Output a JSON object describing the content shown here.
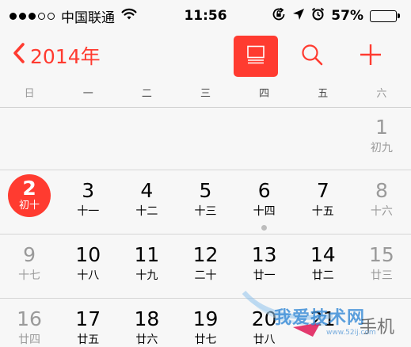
{
  "status_bar": {
    "signal_dots": [
      true,
      true,
      true,
      false,
      false
    ],
    "carrier": "中国联通",
    "wifi_icon": "wifi-icon",
    "time": "11:56",
    "lock_rotation_icon": "orientation-lock-icon",
    "location_icon": "location-arrow-icon",
    "alarm_icon": "alarm-clock-icon",
    "battery_percent": "57%",
    "battery_level": 0.57
  },
  "nav": {
    "back_label": "2014年",
    "back_icon": "chevron-left-icon",
    "list_icon": "list-view-icon",
    "search_icon": "search-icon",
    "add_icon": "plus-icon",
    "accent_color": "#ff3b30"
  },
  "weekdays": [
    "日",
    "一",
    "二",
    "三",
    "四",
    "五",
    "六"
  ],
  "weeks": [
    [
      {
        "day": "",
        "lunar": ""
      },
      {
        "day": "",
        "lunar": ""
      },
      {
        "day": "",
        "lunar": ""
      },
      {
        "day": "",
        "lunar": ""
      },
      {
        "day": "",
        "lunar": ""
      },
      {
        "day": "",
        "lunar": ""
      },
      {
        "day": "1",
        "lunar": "初九"
      }
    ],
    [
      {
        "day": "2",
        "lunar": "初十",
        "today": true
      },
      {
        "day": "3",
        "lunar": "十一"
      },
      {
        "day": "4",
        "lunar": "十二"
      },
      {
        "day": "5",
        "lunar": "十三"
      },
      {
        "day": "6",
        "lunar": "十四",
        "event": true
      },
      {
        "day": "7",
        "lunar": "十五"
      },
      {
        "day": "8",
        "lunar": "十六"
      }
    ],
    [
      {
        "day": "9",
        "lunar": "十七"
      },
      {
        "day": "10",
        "lunar": "十八"
      },
      {
        "day": "11",
        "lunar": "十九"
      },
      {
        "day": "12",
        "lunar": "二十"
      },
      {
        "day": "13",
        "lunar": "廿一"
      },
      {
        "day": "14",
        "lunar": "廿二"
      },
      {
        "day": "15",
        "lunar": "廿三"
      }
    ],
    [
      {
        "day": "16",
        "lunar": "廿四"
      },
      {
        "day": "17",
        "lunar": "廿五"
      },
      {
        "day": "18",
        "lunar": "廿六"
      },
      {
        "day": "19",
        "lunar": "廿七"
      },
      {
        "day": "20",
        "lunar": "廿八"
      },
      {
        "day": "21",
        "lunar": ""
      },
      {
        "day": "",
        "lunar": ""
      }
    ]
  ],
  "watermark": {
    "text": "我爱技术网",
    "text2": "手机",
    "url": "www.52ij.com"
  }
}
